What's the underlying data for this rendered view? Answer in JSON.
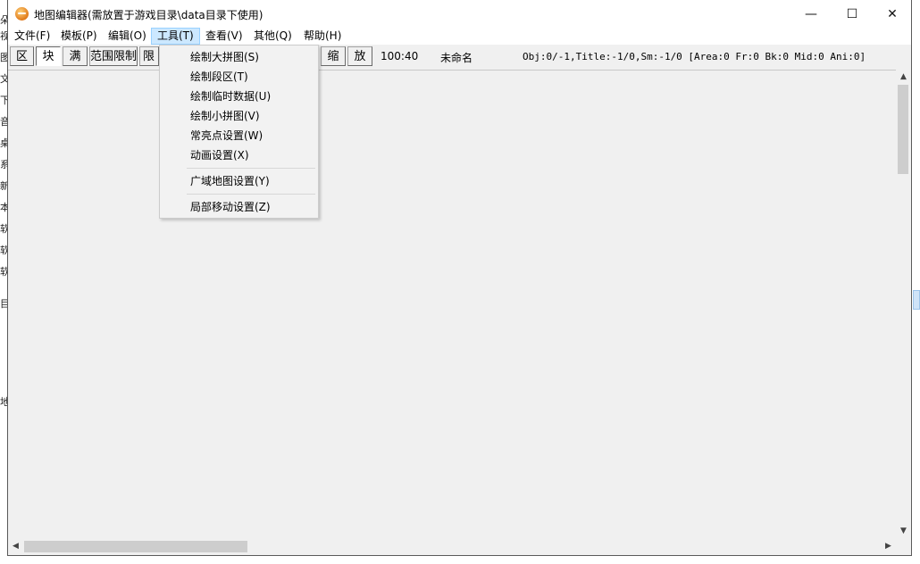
{
  "window": {
    "title": "地图编辑器(需放置于游戏目录\\data目录下使用)",
    "minimize": "—",
    "maximize": "☐",
    "close": "✕"
  },
  "menubar": [
    {
      "label": "文件(F)"
    },
    {
      "label": "模板(P)"
    },
    {
      "label": "编辑(O)"
    },
    {
      "label": "工具(T)"
    },
    {
      "label": "查看(V)"
    },
    {
      "label": "其他(Q)"
    },
    {
      "label": "帮助(H)"
    }
  ],
  "toolbar": {
    "buttons": [
      {
        "label": "区"
      },
      {
        "label": "块"
      },
      {
        "label": "满"
      },
      {
        "label": "范围限制"
      },
      {
        "label": "限"
      },
      {
        "label": "缩"
      },
      {
        "label": "放"
      }
    ],
    "zoom": "100:40",
    "map_name": "未命名",
    "status": "Obj:0/-1,Title:-1/0,Sm:-1/0 [Area:0 Fr:0 Bk:0 Mid:0 Ani:0]"
  },
  "tools_menu": {
    "items": [
      {
        "label": "绘制大拼图(S)"
      },
      {
        "label": "绘制段区(T)"
      },
      {
        "label": "绘制临时数据(U)"
      },
      {
        "label": "绘制小拼图(V)"
      },
      {
        "label": "常亮点设置(W)"
      },
      {
        "label": "动画设置(X)"
      },
      {
        "label": "广域地图设置(Y)"
      },
      {
        "label": "局部移动设置(Z)"
      }
    ]
  },
  "background_chars": [
    "朵",
    "视",
    "图",
    "文",
    "下",
    "音",
    "桌",
    "系",
    "新",
    "本",
    "软",
    "软",
    "软",
    "目",
    "地"
  ],
  "colors": {
    "menu_highlight": "#cce8ff",
    "window_bg": "#f0f0f0",
    "scroll_thumb": "#cdcdcd"
  }
}
